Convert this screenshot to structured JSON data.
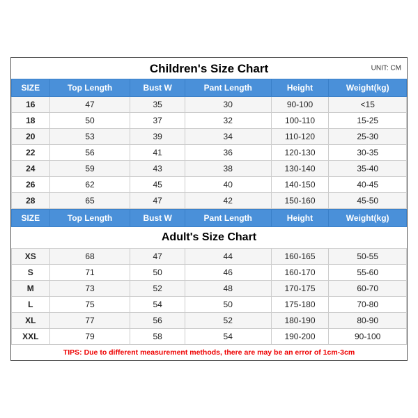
{
  "title": "Children's Size Chart",
  "unit": "UNIT: CM",
  "adults_title": "Adult's Size Chart",
  "tips": "TIPS: Due to different measurement methods, there are may be an error of 1cm-3cm",
  "children_headers": [
    "SIZE",
    "Top Length",
    "Bust W",
    "Pant Length",
    "Height",
    "Weight(kg)"
  ],
  "children_rows": [
    [
      "16",
      "47",
      "35",
      "30",
      "90-100",
      "<15"
    ],
    [
      "18",
      "50",
      "37",
      "32",
      "100-110",
      "15-25"
    ],
    [
      "20",
      "53",
      "39",
      "34",
      "110-120",
      "25-30"
    ],
    [
      "22",
      "56",
      "41",
      "36",
      "120-130",
      "30-35"
    ],
    [
      "24",
      "59",
      "43",
      "38",
      "130-140",
      "35-40"
    ],
    [
      "26",
      "62",
      "45",
      "40",
      "140-150",
      "40-45"
    ],
    [
      "28",
      "65",
      "47",
      "42",
      "150-160",
      "45-50"
    ]
  ],
  "adults_headers": [
    "SIZE",
    "Top Length",
    "Bust W",
    "Pant Length",
    "Height",
    "Weight(kg)"
  ],
  "adults_rows": [
    [
      "XS",
      "68",
      "47",
      "44",
      "160-165",
      "50-55"
    ],
    [
      "S",
      "71",
      "50",
      "46",
      "160-170",
      "55-60"
    ],
    [
      "M",
      "73",
      "52",
      "48",
      "170-175",
      "60-70"
    ],
    [
      "L",
      "75",
      "54",
      "50",
      "175-180",
      "70-80"
    ],
    [
      "XL",
      "77",
      "56",
      "52",
      "180-190",
      "80-90"
    ],
    [
      "XXL",
      "79",
      "58",
      "54",
      "190-200",
      "90-100"
    ]
  ]
}
